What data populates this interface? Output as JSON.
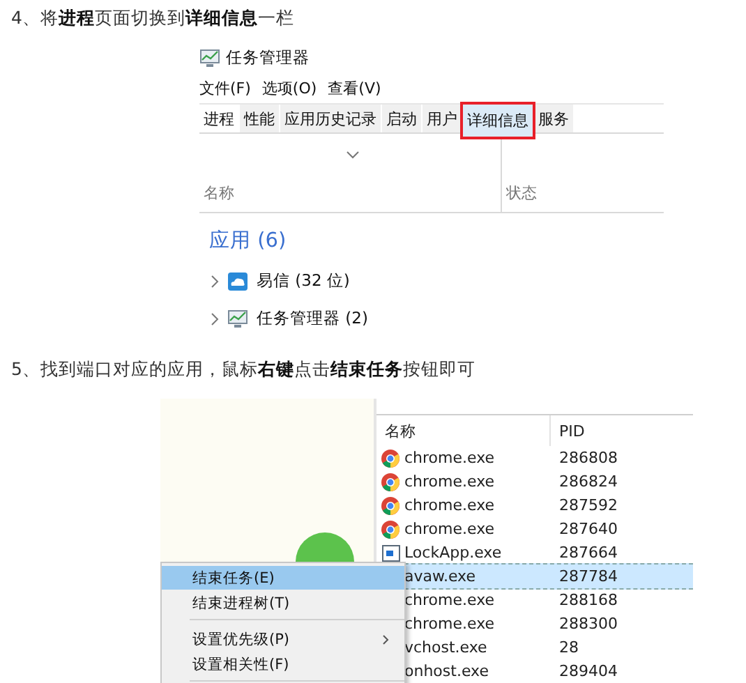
{
  "step_1": {
    "text": "4、将**进程**页面切换到**详细信息**一栏"
  },
  "screenshot_1": {
    "window_title": "任务管理器",
    "menu": [
      "文件(F)",
      "选项(O)",
      "查看(V)"
    ],
    "tabs": [
      {
        "label": "进程",
        "selected": true,
        "annotated": false
      },
      {
        "label": "性能",
        "selected": false,
        "annotated": false
      },
      {
        "label": "应用历史记录",
        "selected": false,
        "annotated": false
      },
      {
        "label": "启动",
        "selected": false,
        "annotated": false
      },
      {
        "label": "用户",
        "selected": false,
        "annotated": false
      },
      {
        "label": "详细信息",
        "selected": false,
        "annotated": true
      },
      {
        "label": "服务",
        "selected": false,
        "annotated": false
      }
    ],
    "columns": [
      "名称",
      "状态"
    ],
    "group": "应用 (6)",
    "rows": [
      {
        "name": "易信 (32 位)",
        "kind": "cloud"
      },
      {
        "name": "任务管理器 (2)",
        "kind": "monitor"
      }
    ]
  },
  "step_2": {
    "text": "5、找到端口对应的应用，鼠标**右键**点击**结束任务**按钮即可"
  },
  "screenshot_2": {
    "columns": [
      "名称",
      "PID"
    ],
    "rows": [
      {
        "name": "chrome.exe",
        "pid": "286808",
        "kind": "chrome",
        "selected": false
      },
      {
        "name": "chrome.exe",
        "pid": "286824",
        "kind": "chrome",
        "selected": false
      },
      {
        "name": "chrome.exe",
        "pid": "287592",
        "kind": "chrome",
        "selected": false
      },
      {
        "name": "chrome.exe",
        "pid": "287640",
        "kind": "chrome",
        "selected": false
      },
      {
        "name": "LockApp.exe",
        "pid": "287664",
        "kind": "app",
        "selected": false
      },
      {
        "name": "avaw.exe",
        "pid": "287784",
        "kind": "hidden",
        "selected": true
      },
      {
        "name": "chrome.exe",
        "pid": "288168",
        "kind": "hidden",
        "selected": false
      },
      {
        "name": "chrome.exe",
        "pid": "288300",
        "kind": "hidden",
        "selected": false
      },
      {
        "name": "vchost.exe",
        "pid": "28",
        "kind": "hidden",
        "selected": false
      },
      {
        "name": "onhost.exe",
        "pid": "289404",
        "kind": "hidden",
        "selected": false
      }
    ],
    "context_menu": [
      {
        "label": "结束任务(E)",
        "selected": true,
        "submenu": false,
        "separator_after": false
      },
      {
        "label": "结束进程树(T)",
        "selected": false,
        "submenu": false,
        "separator_after": true
      },
      {
        "label": "设置优先级(P)",
        "selected": false,
        "submenu": true,
        "separator_after": false
      },
      {
        "label": "设置相关性(F)",
        "selected": false,
        "submenu": false,
        "separator_after": true
      }
    ]
  }
}
